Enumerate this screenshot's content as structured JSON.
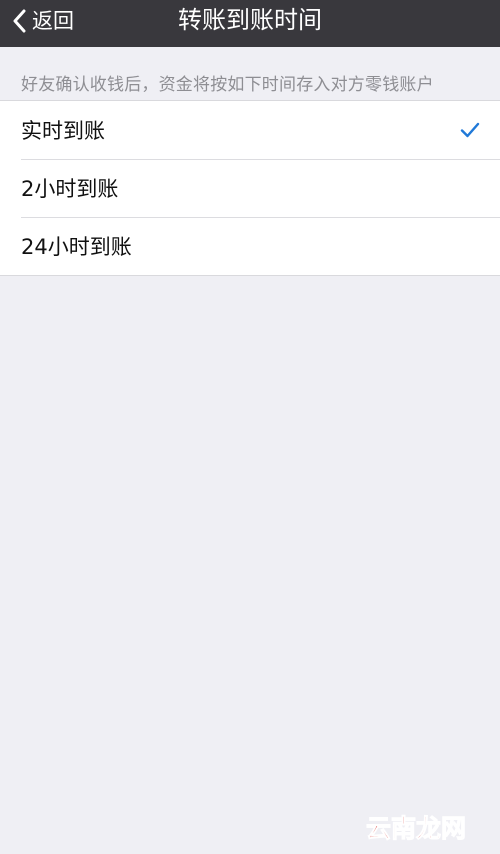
{
  "nav": {
    "back_label": "返回",
    "title": "转账到账时间"
  },
  "hint": "好友确认收钱后，资金将按如下时间存入对方零钱账户",
  "options": [
    {
      "label": "实时到账",
      "selected": true
    },
    {
      "label": "2小时到账",
      "selected": false
    },
    {
      "label": "24小时到账",
      "selected": false
    }
  ],
  "watermark": {
    "text": "云南龙网",
    "color": "#d6221e"
  },
  "colors": {
    "nav_background": "#39383d",
    "page_background": "#efeff4",
    "check_color": "#2079d8"
  }
}
